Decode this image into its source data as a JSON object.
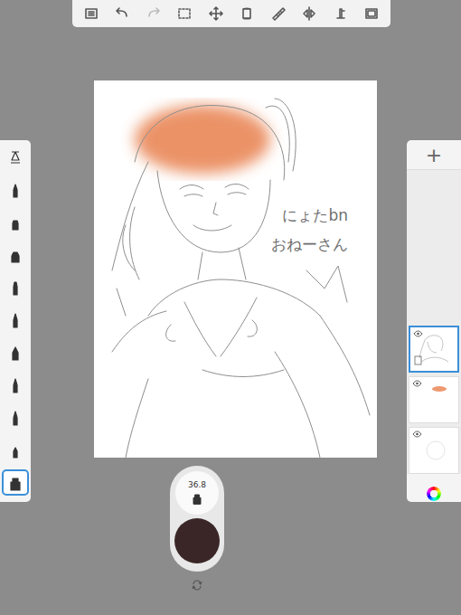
{
  "top_toolbar": [
    {
      "disabled": false
    },
    {
      "disabled": false
    },
    {
      "disabled": true
    },
    {
      "disabled": false
    },
    {
      "disabled": false
    },
    {
      "disabled": false
    },
    {
      "disabled": false
    },
    {
      "disabled": false
    },
    {
      "disabled": false
    },
    {
      "disabled": false
    }
  ],
  "brushes": [
    {
      "selected": false
    },
    {
      "selected": false
    },
    {
      "selected": false
    },
    {
      "selected": false
    },
    {
      "selected": false
    },
    {
      "selected": false
    },
    {
      "selected": false
    },
    {
      "selected": false
    },
    {
      "selected": false
    },
    {
      "selected": false
    },
    {
      "selected": true
    }
  ],
  "canvas": {
    "annotations": [
      "にょたbn",
      "おねーさん"
    ]
  },
  "brush_puck": {
    "size": "36.8",
    "color": "#3a2626"
  },
  "layers": {
    "add_button": "+",
    "items": [
      {
        "visible": true,
        "selected": true
      },
      {
        "visible": true,
        "selected": false
      },
      {
        "visible": true,
        "selected": false
      }
    ]
  }
}
